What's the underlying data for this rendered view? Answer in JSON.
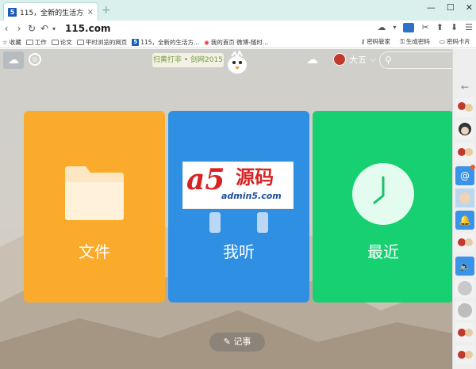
{
  "tab": {
    "title": "115，全新的生活方式！",
    "close": "×",
    "new_tab": "+"
  },
  "window": {
    "min": "—",
    "max": "☐",
    "close": "✕"
  },
  "nav": {
    "back": "‹",
    "forward": "›",
    "reload": "↻",
    "undo": "↶",
    "dropdown": "▾",
    "address": "115.com"
  },
  "nav_right": {
    "cloud": "☁",
    "dropdown": "▾",
    "cut": "✂",
    "upload": "⬆",
    "download": "⬇",
    "menu": "☰"
  },
  "bookmarks": {
    "star": "☆",
    "favorites": "收藏",
    "items": [
      "工作",
      "论文",
      "平时浏览的网页",
      "115，全新的生活方...",
      "我的首页 微博-随时..."
    ],
    "right": [
      "密码管家",
      "生成密码",
      "密码卡片"
    ]
  },
  "app": {
    "promo": "扫黄打非 • 剑网2015",
    "user_name": "大五",
    "user_caret": "⌵",
    "search_icon": "⚲",
    "cloud_icon": "☁",
    "ring_icon": "◎"
  },
  "cards": [
    {
      "label": "文件",
      "color": "#fbab2b"
    },
    {
      "label": "我听",
      "color": "#2f8fe2"
    },
    {
      "label": "最近",
      "color": "#17d071"
    }
  ],
  "watermark": {
    "a5": "a5",
    "cn": "源码",
    "sub": "admin5.com"
  },
  "note_button": {
    "icon": "✎",
    "label": "记事"
  },
  "right_sidebar": {
    "back": "←",
    "at": "@",
    "bell": "🔔",
    "sound": "🔈"
  }
}
